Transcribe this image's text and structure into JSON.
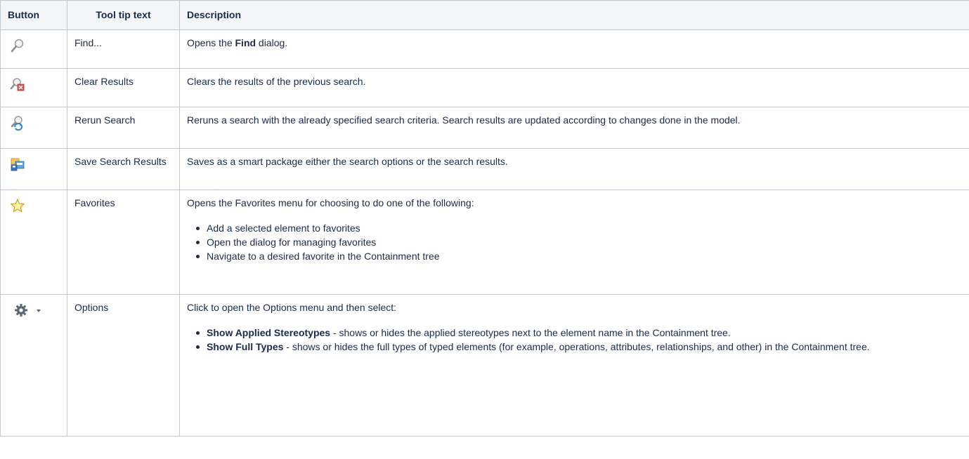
{
  "headers": {
    "button": "Button",
    "tooltip": "Tool tip text",
    "description": "Description"
  },
  "rows": [
    {
      "icon": "find-magnifier-icon",
      "tooltip": "Find...",
      "desc_pre": "Opens the ",
      "desc_bold": "Find",
      "desc_post": " dialog."
    },
    {
      "icon": "clear-results-icon",
      "tooltip": "Clear Results",
      "desc": "Clears the results of the previous search."
    },
    {
      "icon": "rerun-search-icon",
      "tooltip": "Rerun Search",
      "desc": "Reruns a search with the already specified search criteria. Search results are updated according to changes done in the model."
    },
    {
      "icon": "save-search-results-icon",
      "tooltip": "Save Search Results",
      "desc": "Saves as a smart package either the search options or the search results."
    },
    {
      "icon": "favorites-star-icon",
      "tooltip": "Favorites",
      "desc": "Opens the Favorites menu for choosing to do one of the following:",
      "bullets": [
        "Add a selected element to favorites",
        "Open the dialog for managing favorites",
        "Navigate to a desired favorite in the Containment tree"
      ]
    },
    {
      "icon": "options-gear-icon",
      "tooltip": "Options",
      "desc": "Click to open the Options menu and then select:",
      "bullets": [
        {
          "bold": "Show Applied Stereotypes",
          "text": " - shows or hides the applied stereotypes next to the element name in the Containment tree."
        },
        {
          "bold": "Show Full Types",
          "text": " - shows or hides the full types of typed elements (for example, operations, attributes, relationships, and other) in the Containment tree."
        }
      ]
    }
  ],
  "colors": {
    "border": "#c1c7d0",
    "header_bg": "#f4f5f7",
    "text": "#172b4d"
  }
}
